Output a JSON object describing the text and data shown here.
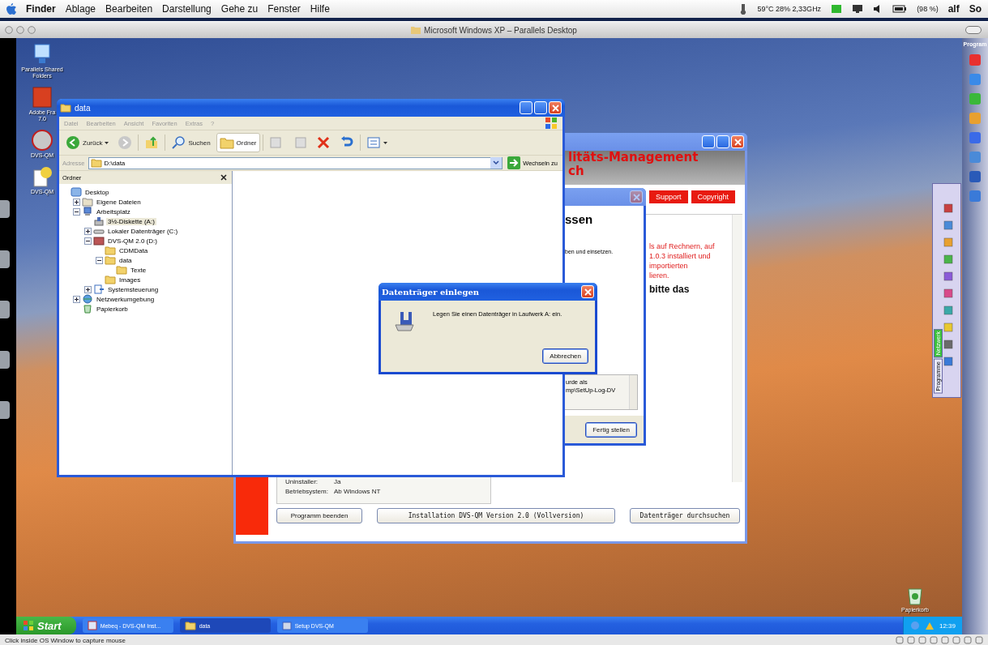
{
  "mac_menubar": {
    "app": "Finder",
    "menus": [
      "Ablage",
      "Bearbeiten",
      "Darstellung",
      "Gehe zu",
      "Fenster",
      "Hilfe"
    ],
    "cpu_monitor": "59°C 28% 2,33GHz",
    "battery": "(98 %)",
    "user": "alf",
    "cut_item": "So"
  },
  "parallels_window": {
    "title": "Microsoft Windows XP – Parallels Desktop",
    "status_bar": "Click inside OS Window to capture mouse"
  },
  "sidebar": {
    "label": "Program",
    "palette_tabs": [
      {
        "label": "Netzwerk",
        "selected": true
      },
      {
        "label": "Programme",
        "selected": false
      }
    ]
  },
  "desktop_icons": [
    {
      "kind": "shared",
      "lines": [
        "Parallels Shared",
        "Folders"
      ]
    },
    {
      "kind": "pdf",
      "lines": [
        "Adobe Fra",
        "7.0"
      ]
    },
    {
      "kind": "dvs",
      "lines": [
        "DVS-QM"
      ]
    },
    {
      "kind": "help",
      "lines": [
        "DVS-QM"
      ]
    }
  ],
  "recycle_bin": {
    "label": "Papierkorb"
  },
  "explorer": {
    "title": "data",
    "menus": [
      "Datei",
      "Bearbeiten",
      "Ansicht",
      "Favoriten",
      "Extras",
      "?"
    ],
    "toolbar": [
      {
        "kind": "back",
        "label": "Zurück",
        "selected": false
      },
      {
        "kind": "forward",
        "selected": false
      },
      {
        "kind": "up",
        "selected": false
      },
      {
        "kind": "search",
        "label": "Suchen",
        "selected": false
      },
      {
        "kind": "folders",
        "label": "Ordner",
        "selected": true
      },
      {
        "kind": "move",
        "selected": false
      },
      {
        "kind": "copy",
        "selected": false
      },
      {
        "kind": "delete",
        "selected": false
      },
      {
        "kind": "undo",
        "selected": false
      },
      {
        "kind": "views",
        "selected": false
      }
    ],
    "address_label": "Adresse",
    "address": "D:\\data",
    "go": "Wechseln zu",
    "pane_title": "Ordner",
    "tree": [
      {
        "kind": "desktop",
        "label": "Desktop",
        "selected": false,
        "children": [
          {
            "kind": "docs",
            "label": "Eigene Dateien",
            "expanded": false,
            "selected": false
          },
          {
            "kind": "computer",
            "label": "Arbeitsplatz",
            "expanded": true,
            "selected": false,
            "children": [
              {
                "kind": "floppy",
                "label": "3½-Diskette (A:)",
                "selected": true
              },
              {
                "kind": "disk",
                "label": "Lokaler Datenträger (C:)",
                "expanded": false,
                "selected": false
              },
              {
                "kind": "cd",
                "label": "DVS-QM 2.0 (D:)",
                "expanded": true,
                "selected": false,
                "children": [
                  {
                    "kind": "folder",
                    "label": "CDMData",
                    "selected": false
                  },
                  {
                    "kind": "folder",
                    "label": "data",
                    "expanded": true,
                    "selected": false,
                    "children": [
                      {
                        "kind": "folder",
                        "label": "Texte",
                        "selected": false
                      }
                    ]
                  },
                  {
                    "kind": "folder",
                    "label": "Images",
                    "selected": false
                  }
                ]
              },
              {
                "kind": "control",
                "label": "Systemsteuerung",
                "expanded": false,
                "selected": false
              }
            ]
          },
          {
            "kind": "network",
            "label": "Netzwerkumgebung",
            "expanded": false,
            "selected": false
          },
          {
            "kind": "recycle",
            "label": "Papierkorb",
            "selected": false
          }
        ]
      }
    ]
  },
  "setup_window": {
    "header": [
      "litäts-Management",
      "ch"
    ],
    "nav": [
      "Support",
      "Copyright"
    ],
    "notice": [
      "ls auf Rechnern, auf",
      "1.0.3 installiert und",
      "importierten",
      "lieren."
    ],
    "notice_bold": "bitte das",
    "info": [
      {
        "label": "Uninstaller:",
        "value": "Ja"
      },
      {
        "label": "Betriebsystem:",
        "value": "Ab Windows NT"
      }
    ],
    "buttons": [
      "Programm beenden",
      "Installation DVS-QM Version 2.0 (Vollversion)",
      "Datenträger durchsuchen"
    ]
  },
  "wizard": {
    "heading": "ssen",
    "text": "ben und einsetzen.",
    "log": [
      "urde als",
      "mp\\SetUp-Log-DV"
    ],
    "button": "Fertig stellen"
  },
  "dialog": {
    "title": "Datenträger einlegen",
    "message": "Legen Sie einen Datenträger in Laufwerk A: ein.",
    "button": "Abbrechen"
  },
  "taskbar": {
    "start": "Start",
    "items": [
      {
        "kind": "app",
        "label": "Mebeq - DVS-QM Inst...",
        "selected": false
      },
      {
        "kind": "folder",
        "label": "data",
        "selected": true
      },
      {
        "kind": "setup",
        "label": "Setup DVS-QM",
        "selected": false
      }
    ],
    "clock": "12:39"
  }
}
